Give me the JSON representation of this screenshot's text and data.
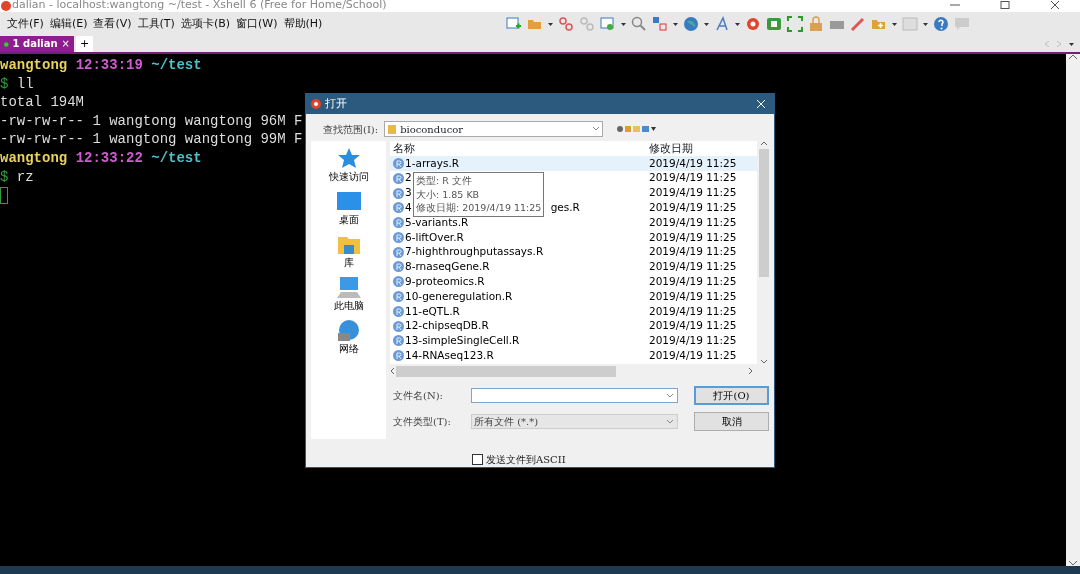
{
  "window": {
    "title": "dalian - localhost:wangtong ~/test - Xshell 6 (Free for Home/School)"
  },
  "menu": [
    "文件(F)",
    "编辑(E)",
    "查看(V)",
    "工具(T)",
    "选项卡(B)",
    "窗口(W)",
    "帮助(H)"
  ],
  "tabs": [
    {
      "label": "1 dalian",
      "selected": true,
      "connected": true,
      "close": "×"
    }
  ],
  "new_tab": "+",
  "terminal": {
    "lines": [
      [
        {
          "kind": "user",
          "text": "wangtong"
        },
        {
          "kind": "time",
          "text": "12:33:19"
        },
        {
          "kind": "path",
          "text": "~/test"
        }
      ],
      [
        {
          "kind": "prompt",
          "text": "$"
        },
        {
          "kind": "output",
          "text": "ll"
        }
      ],
      [
        {
          "kind": "output",
          "text": "total 194M"
        }
      ],
      [
        {
          "kind": "output",
          "text": "-rw-rw-r-- 1 wangtong wangtong 96M F"
        }
      ],
      [
        {
          "kind": "output",
          "text": "-rw-rw-r-- 1 wangtong wangtong 99M F"
        }
      ],
      [
        {
          "kind": "user",
          "text": "wangtong"
        },
        {
          "kind": "time",
          "text": "12:33:22"
        },
        {
          "kind": "path",
          "text": "~/test"
        }
      ],
      [
        {
          "kind": "prompt",
          "text": "$"
        },
        {
          "kind": "output",
          "text": "rz"
        }
      ]
    ],
    "cursor": true
  },
  "dialog": {
    "title": "打开",
    "look_in_label": "查找范围(I):",
    "look_in_value": "bioconducor",
    "places": [
      {
        "kind": "star",
        "label": "快速访问"
      },
      {
        "kind": "desktop",
        "label": "桌面"
      },
      {
        "kind": "library",
        "label": "库"
      },
      {
        "kind": "computer",
        "label": "此电脑"
      },
      {
        "kind": "network",
        "label": "网络"
      }
    ],
    "columns": [
      "名称",
      "修改日期"
    ],
    "rows": [
      {
        "name": "1-arrays.R",
        "date": "2019/4/19 11:25",
        "selected": true
      },
      {
        "name": "2",
        "date": "2019/4/19 11:25",
        "selected": false
      },
      {
        "name": "3",
        "date": "2019/4/19 11:25",
        "selected": false
      },
      {
        "name": "4",
        "name_after": "ges.R",
        "date": "2019/4/19 11:25",
        "selected": false
      },
      {
        "name": "5-variants.R",
        "date": "2019/4/19 11:25",
        "selected": false
      },
      {
        "name": "6-liftOver.R",
        "date": "2019/4/19 11:25",
        "selected": false
      },
      {
        "name": "7-highthroughputassays.R",
        "date": "2019/4/19 11:25",
        "selected": false
      },
      {
        "name": "8-rnaseqGene.R",
        "date": "2019/4/19 11:25",
        "selected": false
      },
      {
        "name": "9-proteomics.R",
        "date": "2019/4/19 11:25",
        "selected": false
      },
      {
        "name": "10-generegulation.R",
        "date": "2019/4/19 11:25",
        "selected": false
      },
      {
        "name": "11-eQTL.R",
        "date": "2019/4/19 11:25",
        "selected": false
      },
      {
        "name": "12-chipseqDB.R",
        "date": "2019/4/19 11:25",
        "selected": false
      },
      {
        "name": "13-simpleSingleCell.R",
        "date": "2019/4/19 11:25",
        "selected": false
      },
      {
        "name": "14-RNAseq123.R",
        "date": "2019/4/19 11:25",
        "selected": false
      }
    ],
    "tooltip": [
      "类型: R 文件",
      "大小: 1.85 KB",
      "修改日期: 2019/4/19 11:25"
    ],
    "filename_label": "文件名(N):",
    "filetype_label": "文件类型(T):",
    "filetype_value": "所有文件 (*.*)",
    "buttons": [
      "打开(O)",
      "取消"
    ],
    "checkbox": {
      "label": "发送文件到ASCII",
      "checked": false
    }
  }
}
